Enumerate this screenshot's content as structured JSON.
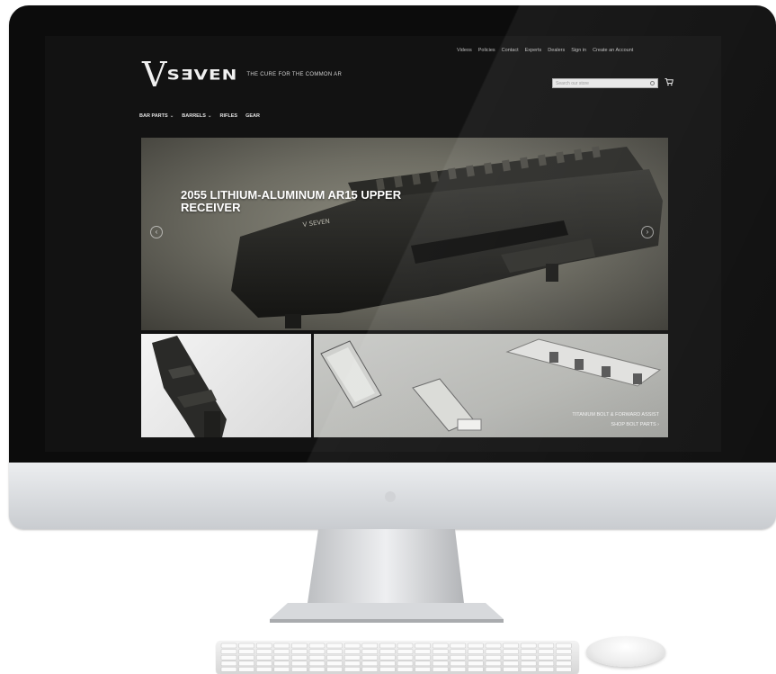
{
  "site": {
    "util_links": [
      "Videos",
      "Policies",
      "Contact",
      "Experts",
      "Dealers",
      "Sign in",
      "Create an Account"
    ],
    "logo": {
      "mark": "V",
      "wordmark": "SƎVEN",
      "tagline": "THE CURE FOR THE COMMON AR"
    },
    "search": {
      "placeholder": "Search our store"
    },
    "nav": [
      {
        "label": "BAR PARTS",
        "has_caret": true
      },
      {
        "label": "BARRELS",
        "has_caret": true
      },
      {
        "label": "RIFLES",
        "has_caret": false
      },
      {
        "label": "GEAR",
        "has_caret": false
      }
    ],
    "hero": {
      "title": "2055 LITHIUM-ALUMINUM AR15 UPPER RECEIVER",
      "engraving": "V SEVEN",
      "prev_glyph": "‹",
      "next_glyph": "›"
    },
    "tiles": {
      "right_caption": "TITANIUM BOLT & FORWARD ASSIST",
      "right_sub": "SHOP BOLT PARTS ›"
    }
  },
  "colors": {
    "screen_bg": "#121212",
    "text_light": "#f0f0f0",
    "hero_olive": "#6d6c62"
  },
  "icons": [
    "search-icon",
    "cart-icon",
    "chevron-left-icon",
    "chevron-right-icon"
  ]
}
